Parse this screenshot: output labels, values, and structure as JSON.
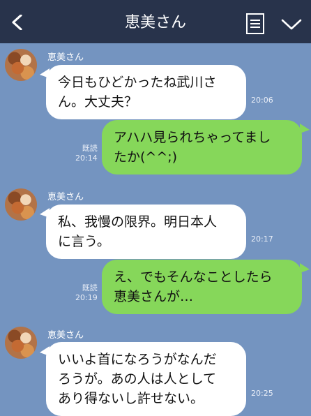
{
  "header": {
    "title": "恵美さん"
  },
  "colors": {
    "background": "#7494c0",
    "header": "#28334b",
    "incoming_bubble": "#ffffff",
    "outgoing_bubble": "#86d75a"
  },
  "icons": {
    "back": "chevron-left-icon",
    "menu": "document-menu-icon",
    "expand": "chevron-down-icon"
  },
  "messages": [
    {
      "sender": "恵美さん",
      "lines": [
        "今日もひどかったね武川さ",
        "ん。大丈夫？"
      ],
      "time": "20:06"
    },
    {
      "read": "既読",
      "lines": [
        "アハハ見られちゃってまし",
        "たか(^^;)"
      ],
      "time": "20:14"
    },
    {
      "sender": "恵美さん",
      "lines": [
        "私、我慢の限界。明日本人",
        "に言う。"
      ],
      "time": "20:17"
    },
    {
      "read": "既読",
      "lines": [
        "え、でもそんなことしたら",
        "恵美さんが…"
      ],
      "time": "20:19"
    },
    {
      "sender": "恵美さん",
      "lines": [
        "いいよ首になろうがなんだ",
        "ろうが。あの人は人として",
        "あり得ないし許せない。"
      ],
      "time": "20:25"
    }
  ]
}
